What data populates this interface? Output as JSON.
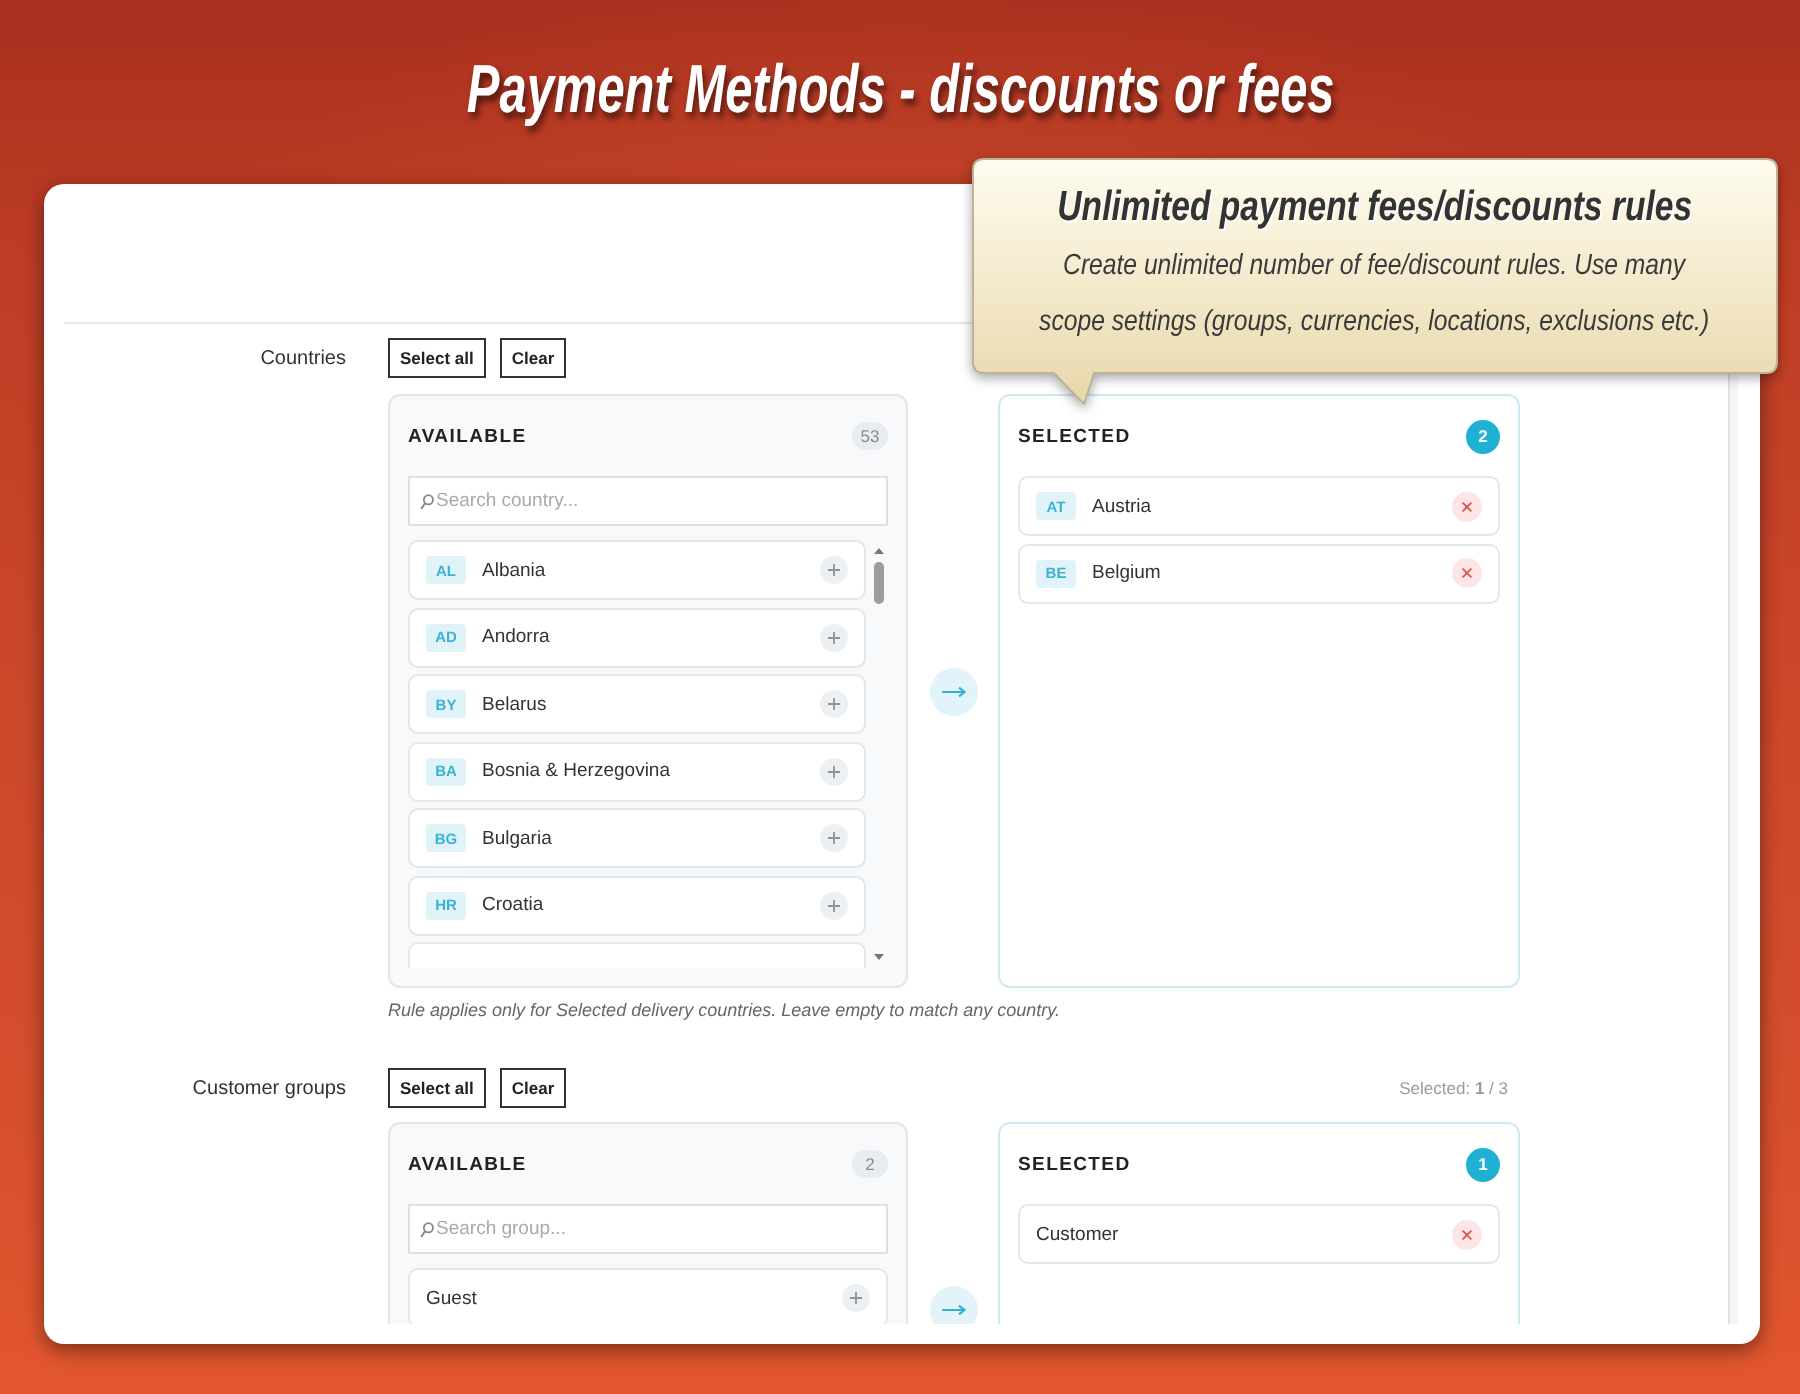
{
  "header": {
    "title": "Payment Methods - discounts or fees"
  },
  "tooltip": {
    "title": "Unlimited payment fees/discounts rules",
    "text": "Create unlimited number of fee/discount rules. Use many\nscope settings (groups, currencies, locations, exclusions etc.)"
  },
  "sections": [
    {
      "label": "Countries",
      "buttons": [
        "Select all",
        "Clear"
      ],
      "available": {
        "title": "AVAILABLE",
        "count": "53",
        "search": {
          "placeholder": "Search country..."
        },
        "scrollable": true,
        "row_cut_off_below": true,
        "items": [
          {
            "code": "AL",
            "name": "Albania"
          },
          {
            "code": "AD",
            "name": "Andorra"
          },
          {
            "code": "BY",
            "name": "Belarus"
          },
          {
            "code": "BA",
            "name": "Bosnia & Herzegovina"
          },
          {
            "code": "BG",
            "name": "Bulgaria"
          },
          {
            "code": "HR",
            "name": "Croatia"
          }
        ]
      },
      "selected": {
        "title": "SELECTED",
        "count": "2",
        "items": [
          {
            "code": "AT",
            "name": "Austria"
          },
          {
            "code": "BE",
            "name": "Belgium"
          }
        ]
      },
      "hint": "Rule applies only for Selected delivery countries. Leave empty to match any country."
    },
    {
      "label": "Customer groups",
      "buttons": [
        "Select all",
        "Clear"
      ],
      "summary": "Selected: **1** / 3",
      "available": {
        "title": "AVAILABLE",
        "count": "2",
        "search": {
          "placeholder": "Search group..."
        },
        "scrollable": false,
        "items": [
          {
            "name": "Guest"
          }
        ]
      },
      "selected": {
        "title": "SELECTED",
        "count": "1",
        "items": [
          {
            "name": "Customer"
          }
        ]
      }
    }
  ]
}
